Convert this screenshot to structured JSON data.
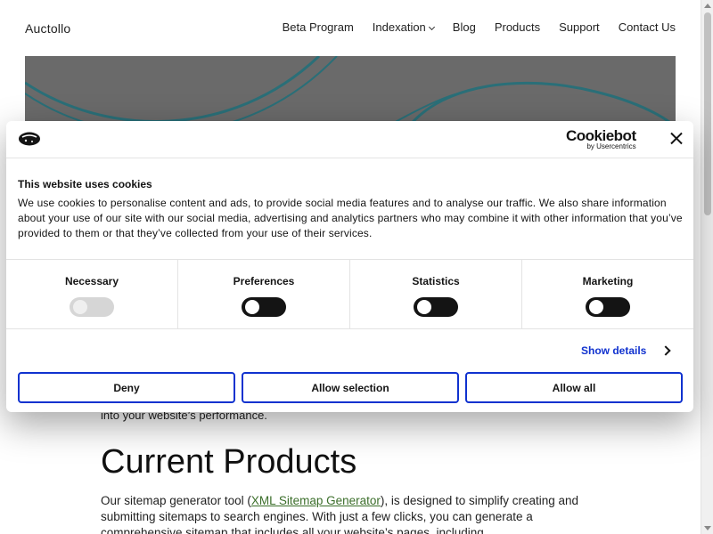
{
  "site": {
    "brand": "Auctollo",
    "nav": [
      {
        "label": "Beta Program"
      },
      {
        "label": "Indexation",
        "has_dropdown": true
      },
      {
        "label": "Blog"
      },
      {
        "label": "Products"
      },
      {
        "label": "Support"
      },
      {
        "label": "Contact Us"
      }
    ]
  },
  "content": {
    "prev_line": "into your website’s performance.",
    "section_title": "Current Products",
    "paragraph_before_link": "Our sitemap generator tool (",
    "paragraph_link": "XML Sitemap Generator",
    "paragraph_after_link": "), is designed to simplify creating and submitting sitemaps to search engines. With just a few clicks, you can generate a comprehensive sitemap that includes all your website’s pages, including"
  },
  "cookie_dialog": {
    "provider_name": "Cookiebot",
    "provider_by": "by Usercentrics",
    "title": "This website uses cookies",
    "body": "We use cookies to personalise content and ads, to provide social media features and to analyse our traffic. We also share information about your use of our site with our social media, advertising and analytics partners who may combine it with other information that you’ve provided to them or that they’ve collected from your use of their services.",
    "categories": [
      {
        "label": "Necessary",
        "enabled": false,
        "disabled": true
      },
      {
        "label": "Preferences",
        "enabled": false,
        "disabled": false
      },
      {
        "label": "Statistics",
        "enabled": false,
        "disabled": false
      },
      {
        "label": "Marketing",
        "enabled": false,
        "disabled": false
      }
    ],
    "show_details": "Show details",
    "buttons": {
      "deny": "Deny",
      "allow_selection": "Allow selection",
      "allow_all": "Allow all"
    }
  },
  "colors": {
    "accent": "#1032cf",
    "toggle_off": "#141414",
    "link": "#3b6e2a",
    "hero_bg": "#6a6a6a",
    "hero_stroke": "#2a6f78"
  }
}
